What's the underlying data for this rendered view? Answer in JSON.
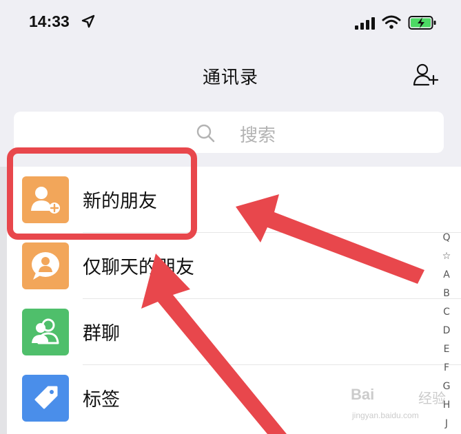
{
  "status_bar": {
    "time": "14:33"
  },
  "nav": {
    "title": "通讯录"
  },
  "search": {
    "placeholder": "搜索"
  },
  "list": [
    {
      "label": "新的朋友",
      "icon": "add-friend-icon",
      "color": "#f2a65a"
    },
    {
      "label": "仅聊天的朋友",
      "icon": "chat-friend-icon",
      "color": "#f2a65a"
    },
    {
      "label": "群聊",
      "icon": "group-chat-icon",
      "color": "#4fbf6b"
    },
    {
      "label": "标签",
      "icon": "tag-icon",
      "color": "#4a8eea"
    }
  ],
  "index_bar": [
    "Q",
    "☆",
    "A",
    "B",
    "C",
    "D",
    "E",
    "F",
    "G",
    "H",
    "J"
  ],
  "watermark": {
    "logo": "Bai",
    "logo_suffix": "经验",
    "url": "jingyan.baidu.com"
  },
  "colors": {
    "accent_highlight": "#e8474c",
    "nav_background": "#efeff4"
  }
}
